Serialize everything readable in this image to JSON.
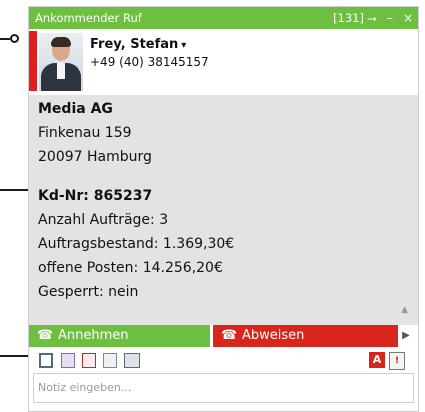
{
  "window": {
    "title": "Ankommender Ruf",
    "counter": "[131]",
    "pin_icon": "pin-icon",
    "minimize_icon": "minimize-icon",
    "close_icon": "close-icon"
  },
  "caller": {
    "name": "Frey, Stefan",
    "dropdown_icon": "chevron-down-icon",
    "phone": "+49 (40) 38145157"
  },
  "customer": {
    "company": "Media AG",
    "street": "Finkenau 159",
    "city": "20097 Hamburg",
    "customer_no": "Kd-Nr: 865237",
    "orders": "Anzahl Aufträge: 3",
    "order_volume": "Auftragsbestand: 1.369,30€",
    "open_items": "offene Posten: 14.256,20€",
    "blocked": "Gesperrt: nein"
  },
  "actions": {
    "accept_label": "Annehmen",
    "reject_label": "Abweisen",
    "accept_icon": "phone-icon",
    "reject_icon": "phone-hangup-icon",
    "more_icon": "chevron-right-icon"
  },
  "toolbar": {
    "icons": [
      "contact-card-icon",
      "calendar-icon",
      "pdf-icon",
      "documents-icon",
      "screen-icon"
    ],
    "right_label": "A",
    "right_doc_label": "!"
  },
  "note": {
    "placeholder": "Notiz eingeben..."
  },
  "colors": {
    "green": "#6cbf3f",
    "red": "#d9261c",
    "info_bg": "#e3e3e3"
  }
}
